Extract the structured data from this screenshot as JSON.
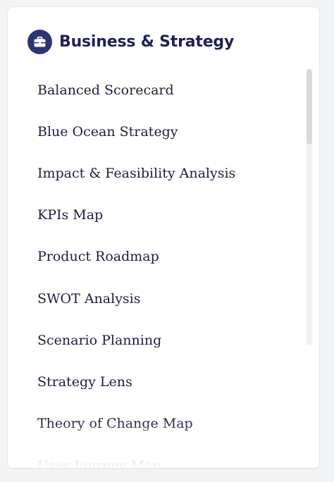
{
  "header": {
    "icon": "briefcase-icon",
    "title": "Business & Strategy",
    "icon_bg_color": "#2e3372"
  },
  "items": [
    {
      "label": "Balanced Scorecard"
    },
    {
      "label": "Blue Ocean Strategy"
    },
    {
      "label": "Impact & Feasibility Analysis"
    },
    {
      "label": "KPIs Map"
    },
    {
      "label": "Product Roadmap"
    },
    {
      "label": "SWOT Analysis"
    },
    {
      "label": "Scenario Planning"
    },
    {
      "label": "Strategy Lens"
    },
    {
      "label": "Theory of Change Map"
    },
    {
      "label": "User Journey Map"
    }
  ],
  "colors": {
    "text": "#1b1e3f",
    "title": "#1d2252",
    "accent": "#2e3372"
  },
  "scroll": {
    "position": 0
  }
}
